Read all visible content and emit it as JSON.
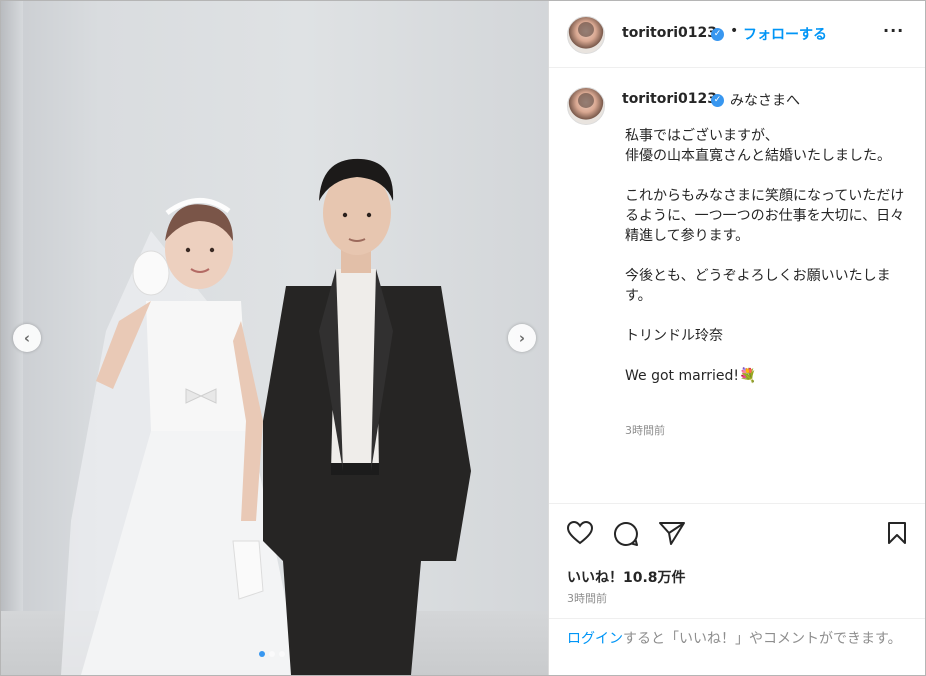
{
  "post": {
    "username": "toritori0123",
    "verified_mark": "✓",
    "separator": "•",
    "follow_label": "フォローする",
    "more_label": "···",
    "nav_prev": "‹",
    "nav_next": "›",
    "carousel": {
      "total": 3,
      "active_index": 0
    }
  },
  "caption": {
    "username": "toritori0123",
    "greeting": "みなさまへ",
    "paragraphs": [
      "私事ではございますが、\n俳優の山本直寛さんと結婚いたしました。",
      "これからもみなさまに笑顔になっていただけるように、一つ一つのお仕事を大切に、日々精進して参ります。",
      "今後とも、どうぞよろしくお願いいたします。",
      "トリンドル玲奈",
      "We got married!💐"
    ],
    "time": "3時間前"
  },
  "actions": {
    "icons": [
      "heart-icon",
      "comment-icon",
      "share-icon",
      "bookmark-icon"
    ],
    "likes": "いいね！10.8万件",
    "time": "3時間前"
  },
  "login": {
    "link": "ログイン",
    "text": "すると「いいね！」やコメントができます。"
  },
  "colors": {
    "link_blue": "#0095f6",
    "verified_blue": "#3897f0",
    "text": "#262626",
    "muted": "#8e8e8e"
  }
}
